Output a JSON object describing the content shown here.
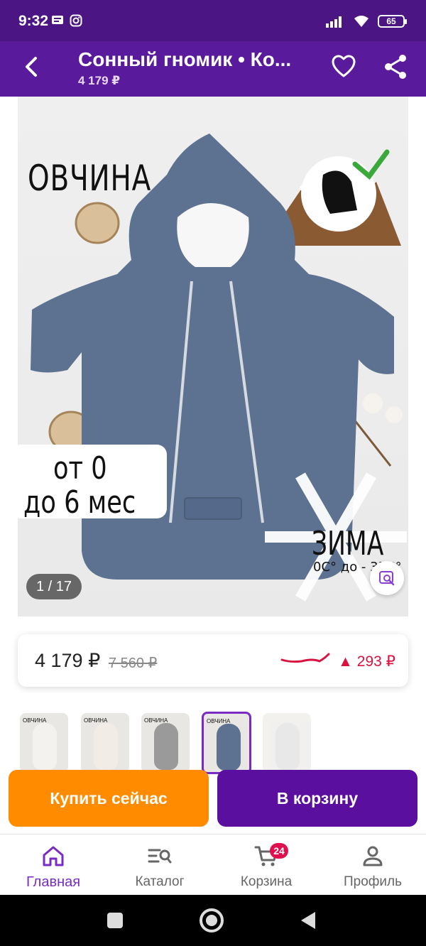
{
  "status_bar": {
    "time": "9:32",
    "battery": "65"
  },
  "header": {
    "title": "Сонный гномик • Ко...",
    "subtitle": "4 179 ₽",
    "back_icon": "back-arrow-icon",
    "favorite_icon": "heart-icon",
    "share_icon": "share-icon"
  },
  "product_image": {
    "label_material": "ОВЧИНА",
    "label_age_line1": "от 0",
    "label_age_line2": "до 6 мес",
    "label_season": "ЗИМА",
    "label_temperature": "0С° до - 35С°",
    "counter": "1 / 17",
    "visual_search_icon": "image-search-icon"
  },
  "price": {
    "current": "4 179 ₽",
    "old": "7 560 ₽",
    "delta": "▲ 293 ₽",
    "trend_color": "#d9123f"
  },
  "thumbnails": [
    {
      "label": "ОВЧИНА",
      "suit_color": "#f4f2ee",
      "active": false
    },
    {
      "label": "ОВЧИНА",
      "suit_color": "#f1ede6",
      "active": false
    },
    {
      "label": "ОВЧИНА",
      "suit_color": "#9a9a9a",
      "active": false
    },
    {
      "label": "ОВЧИНА",
      "suit_color": "#5d7290",
      "active": true
    },
    {
      "label": "",
      "suit_color": "#d9d9d9",
      "active": false
    }
  ],
  "actions": {
    "buy_now": "Купить сейчас",
    "add_to_cart": "В корзину"
  },
  "bottom_nav": {
    "items": [
      {
        "label": "Главная",
        "icon": "home-icon"
      },
      {
        "label": "Каталог",
        "icon": "catalog-search-icon"
      },
      {
        "label": "Корзина",
        "icon": "cart-icon"
      },
      {
        "label": "Профиль",
        "icon": "profile-icon"
      }
    ],
    "cart_badge": "24"
  },
  "colors": {
    "brand": "#5a1a9c",
    "accent_orange": "#ff8c00",
    "accent_purple": "#5a0f9e",
    "active_nav": "#7a2bc4"
  }
}
